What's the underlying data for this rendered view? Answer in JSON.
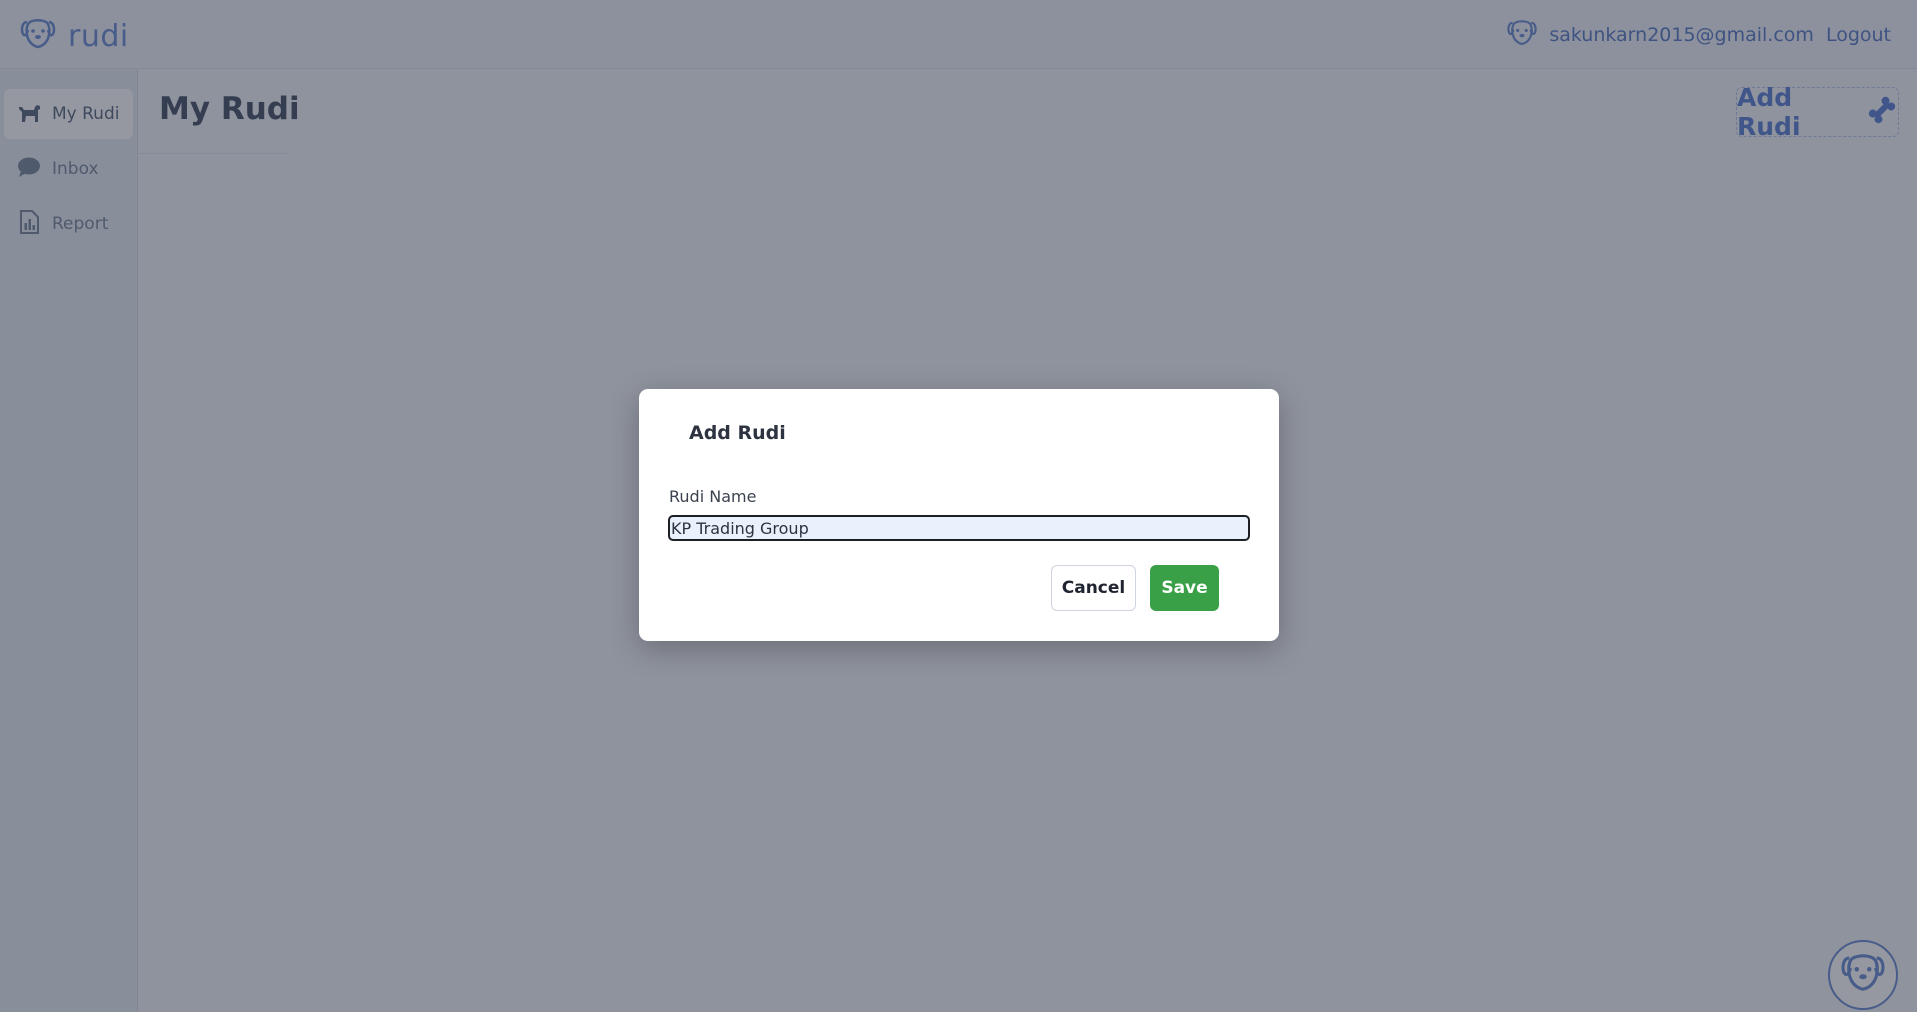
{
  "app": {
    "logo_text": "rudi"
  },
  "header": {
    "user_email": "sakunkarn2015@gmail.com",
    "logout_label": "Logout"
  },
  "sidebar": {
    "items": [
      {
        "label": "My Rudi",
        "icon": "dog-icon",
        "active": true
      },
      {
        "label": "Inbox",
        "icon": "chat-bubble-icon",
        "active": false
      },
      {
        "label": "Report",
        "icon": "report-chart-icon",
        "active": false
      }
    ]
  },
  "main": {
    "page_title": "My Rudi",
    "add_button_label": "Add Rudi",
    "add_button_icon": "bone-icon"
  },
  "modal": {
    "title": "Add Rudi",
    "field_label": "Rudi Name",
    "field_value": "KP Trading Group",
    "cancel_label": "Cancel",
    "save_label": "Save"
  },
  "colors": {
    "accent": "#5f83d6",
    "save": "#3aa047",
    "overlay": "#1d2437"
  }
}
